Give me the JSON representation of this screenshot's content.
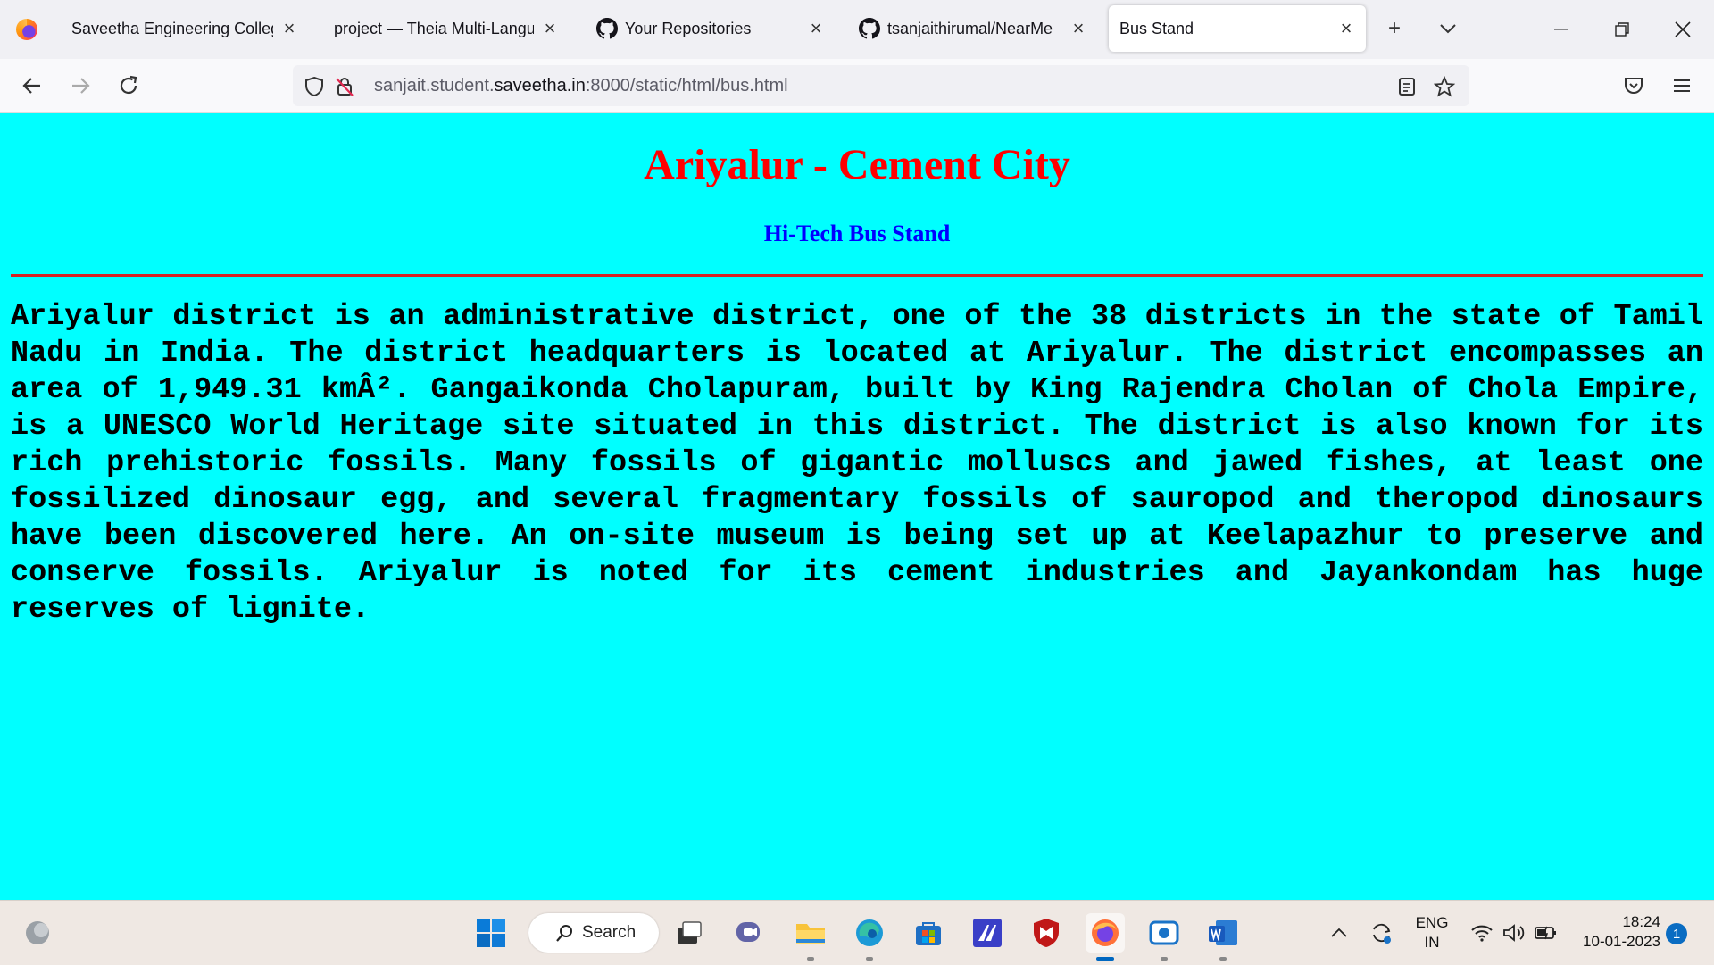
{
  "browser": {
    "tabs": [
      {
        "label": "Saveetha Engineering College",
        "icon": "none",
        "active": false
      },
      {
        "label": "project — Theia Multi-Langua",
        "icon": "none",
        "active": false
      },
      {
        "label": "Your Repositories",
        "icon": "github-icon",
        "active": false
      },
      {
        "label": "tsanjaithirumal/NearMe",
        "icon": "github-icon",
        "active": false
      },
      {
        "label": "Bus Stand",
        "icon": "none",
        "active": true
      }
    ],
    "url_prefix": "sanjait.student.",
    "url_host": "saveetha.in",
    "url_suffix": ":8000/static/html/bus.html"
  },
  "page": {
    "title": "Ariyalur - Cement City",
    "subtitle": "Hi-Tech Bus Stand",
    "paragraph": "Ariyalur district is an administrative district, one of the 38 districts in the state of Tamil Nadu in India. The district headquarters is located at Ariyalur. The district encompasses an area of 1,949.31 kmÂ². Gangaikonda Cholapuram, built by King Rajendra Cholan of Chola Empire, is a UNESCO World Heritage site situated in this district. The district is also known for its rich prehistoric fossils. Many fossils of gigantic molluscs and jawed fishes, at least one fossilized dinosaur egg, and several fragmentary fossils of sauropod and theropod dinosaurs have been discovered here. An on-site museum is being set up at Keelapazhur to preserve and conserve fossils. Ariyalur is noted for its cement industries and Jayankondam has huge reserves of lignite.",
    "colors": {
      "background": "#00ffff",
      "title": "#ff0000",
      "subtitle": "#0000ff",
      "divider": "#d62020"
    }
  },
  "taskbar": {
    "search_label": "Search",
    "language": "ENG",
    "region": "IN",
    "time": "18:24",
    "date": "10-01-2023",
    "notification_count": "1"
  }
}
